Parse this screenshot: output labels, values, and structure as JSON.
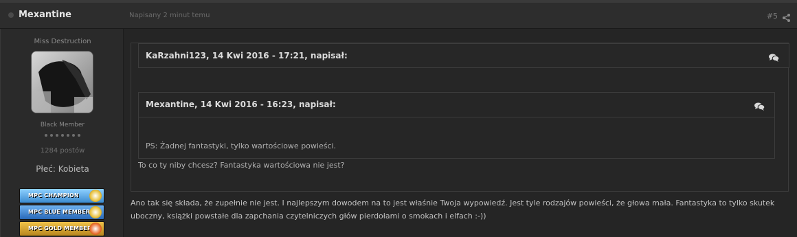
{
  "post": {
    "author": "Mexantine",
    "posted_ago": "Napisany 2 minut temu",
    "number": "#5",
    "body": "Ano tak się składa, że zupełnie nie jest. I najlepszym dowodem na to jest właśnie Twoja wypowiedź. Jest tyle rodzajów powieści, że głowa mała. Fantastyka to tylko skutek uboczny, książki powstałe dla zapchania czytelniczych głów pierdołami o smokach i elfach :-))"
  },
  "profile": {
    "title": "Miss Destruction",
    "group": "Black Member",
    "post_count": "1284 postów",
    "gender": "Płeć: Kobieta",
    "pip_count": 7,
    "awards": [
      {
        "label": "MPC CHAMPION",
        "colors": [
          "#3c8bd0",
          "#8fd1ff"
        ],
        "emblem": "#e8c03a"
      },
      {
        "label": "MPC BLUE MEMBER",
        "colors": [
          "#2868b8",
          "#6fb2f0"
        ],
        "emblem": "#e8c03a"
      },
      {
        "label": "MPC GOLD MEMBER",
        "colors": [
          "#b8861e",
          "#f0c24a"
        ],
        "emblem": "#e86a2a"
      }
    ]
  },
  "quote": {
    "header": "KaRzahni123, 14 Kwi 2016 - 17:21, napisał:",
    "reply": "To co ty niby chcesz? Fantastyka wartościowa nie jest?",
    "nested": {
      "header": "Mexantine, 14 Kwi 2016 - 16:23, napisał:",
      "body": "PS: Żadnej fantastyki, tylko wartościowe powieści."
    }
  },
  "icons": {
    "share": "share-icon",
    "quote": "speech-bubbles-icon",
    "status": "offline-dot-icon"
  }
}
